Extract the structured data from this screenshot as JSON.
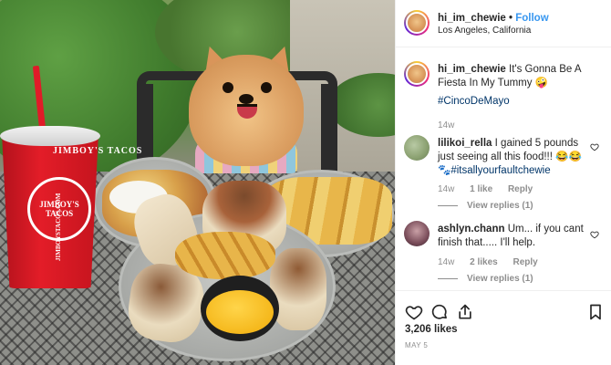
{
  "post": {
    "username": "hi_im_chewie",
    "separator": "•",
    "follow_label": "Follow",
    "location": "Los Angeles, California",
    "caption": {
      "username": "hi_im_chewie",
      "text": "It's Gonna Be A Fiesta In My Tummy",
      "emoji": "🤪",
      "hashtag": "#CincoDeMayo",
      "time": "14w"
    },
    "cup": {
      "brand_top": "JIMBOY'S TACOS",
      "brand_circle": "JIMBOY'S TACOS",
      "brand_side": "JIMBOYSTACOS.COM"
    },
    "likes": "3,206 likes",
    "date": "MAY 5"
  },
  "comments": [
    {
      "username": "lilikoi_rella",
      "text": "I gained 5 pounds just seeing all this food!!!",
      "emoji": "😂😂",
      "paw": "🐾",
      "hashtag": "#itsallyourfaultchewie",
      "time": "14w",
      "likes": "1 like",
      "reply_label": "Reply",
      "view_replies": "View replies (1)"
    },
    {
      "username": "ashlyn.chann",
      "text": "Um... if you cant finish that..... I'll help.",
      "time": "14w",
      "likes": "2 likes",
      "reply_label": "Reply",
      "view_replies": "View replies (1)"
    }
  ],
  "icons": [
    "heart-icon",
    "comment-icon",
    "share-icon",
    "bookmark-icon",
    "comment-heart-icon"
  ],
  "colors": {
    "link": "#3897f0",
    "hashtag": "#003569",
    "muted": "#8e8e8e",
    "text": "#262626",
    "cup_red": "#e31d28"
  }
}
